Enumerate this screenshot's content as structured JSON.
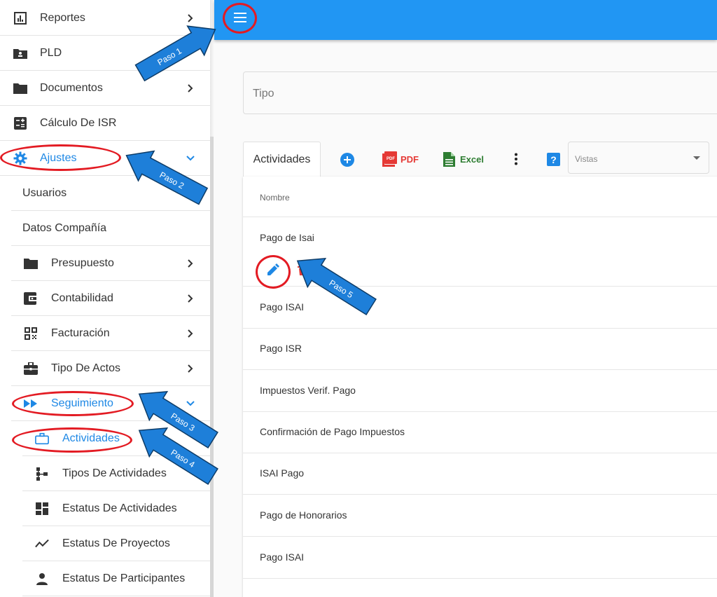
{
  "sidebar": {
    "items": [
      {
        "label": "Reportes",
        "icon": "bar-chart-icon"
      },
      {
        "label": "PLD",
        "icon": "contact-folder-icon"
      },
      {
        "label": "Documentos",
        "icon": "folder-icon"
      },
      {
        "label": "Cálculo De ISR",
        "icon": "calculator-icon"
      },
      {
        "label": "Ajustes",
        "icon": "gear-icon"
      },
      {
        "label": "Usuarios"
      },
      {
        "label": "Datos Compañía"
      },
      {
        "label": "Presupuesto",
        "icon": "folder-icon"
      },
      {
        "label": "Contabilidad",
        "icon": "wallet-icon"
      },
      {
        "label": "Facturación",
        "icon": "qr-code-icon"
      },
      {
        "label": "Tipo De Actos",
        "icon": "briefcase-icon"
      },
      {
        "label": "Seguimiento",
        "icon": "fast-forward-icon"
      },
      {
        "label": "Actividades",
        "icon": "briefcase-outline-icon"
      },
      {
        "label": "Tipos De Actividades",
        "icon": "hierarchy-icon"
      },
      {
        "label": "Estatus De Actividades",
        "icon": "dashboard-icon"
      },
      {
        "label": "Estatus De Proyectos",
        "icon": "trend-line-icon"
      },
      {
        "label": "Estatus De Participantes",
        "icon": "person-icon"
      }
    ]
  },
  "main": {
    "tipo_label": "Tipo",
    "tab_label": "Actividades",
    "toolbar": {
      "pdf_label": "PDF",
      "excel_label": "Excel",
      "vistas_label": "Vistas"
    },
    "table": {
      "column_header": "Nombre",
      "rows": [
        "Pago de Isai",
        "Pago ISAI",
        "Pago ISR",
        "Impuestos Verif. Pago",
        "Confirmación de Pago Impuestos",
        "ISAI Pago",
        "Pago de Honorarios",
        "Pago ISAI"
      ]
    }
  },
  "annotations": {
    "paso1": "Paso 1",
    "paso2": "Paso 2",
    "paso3": "Paso 3",
    "paso4": "Paso 4",
    "paso5": "Paso 5"
  },
  "colors": {
    "brand": "#2196f3",
    "active": "#1e88e5",
    "annotation_ring": "#e31b23",
    "arrow_fill": "#1e7fd9",
    "pdf_red": "#e53935",
    "excel_green": "#2e7d32"
  }
}
